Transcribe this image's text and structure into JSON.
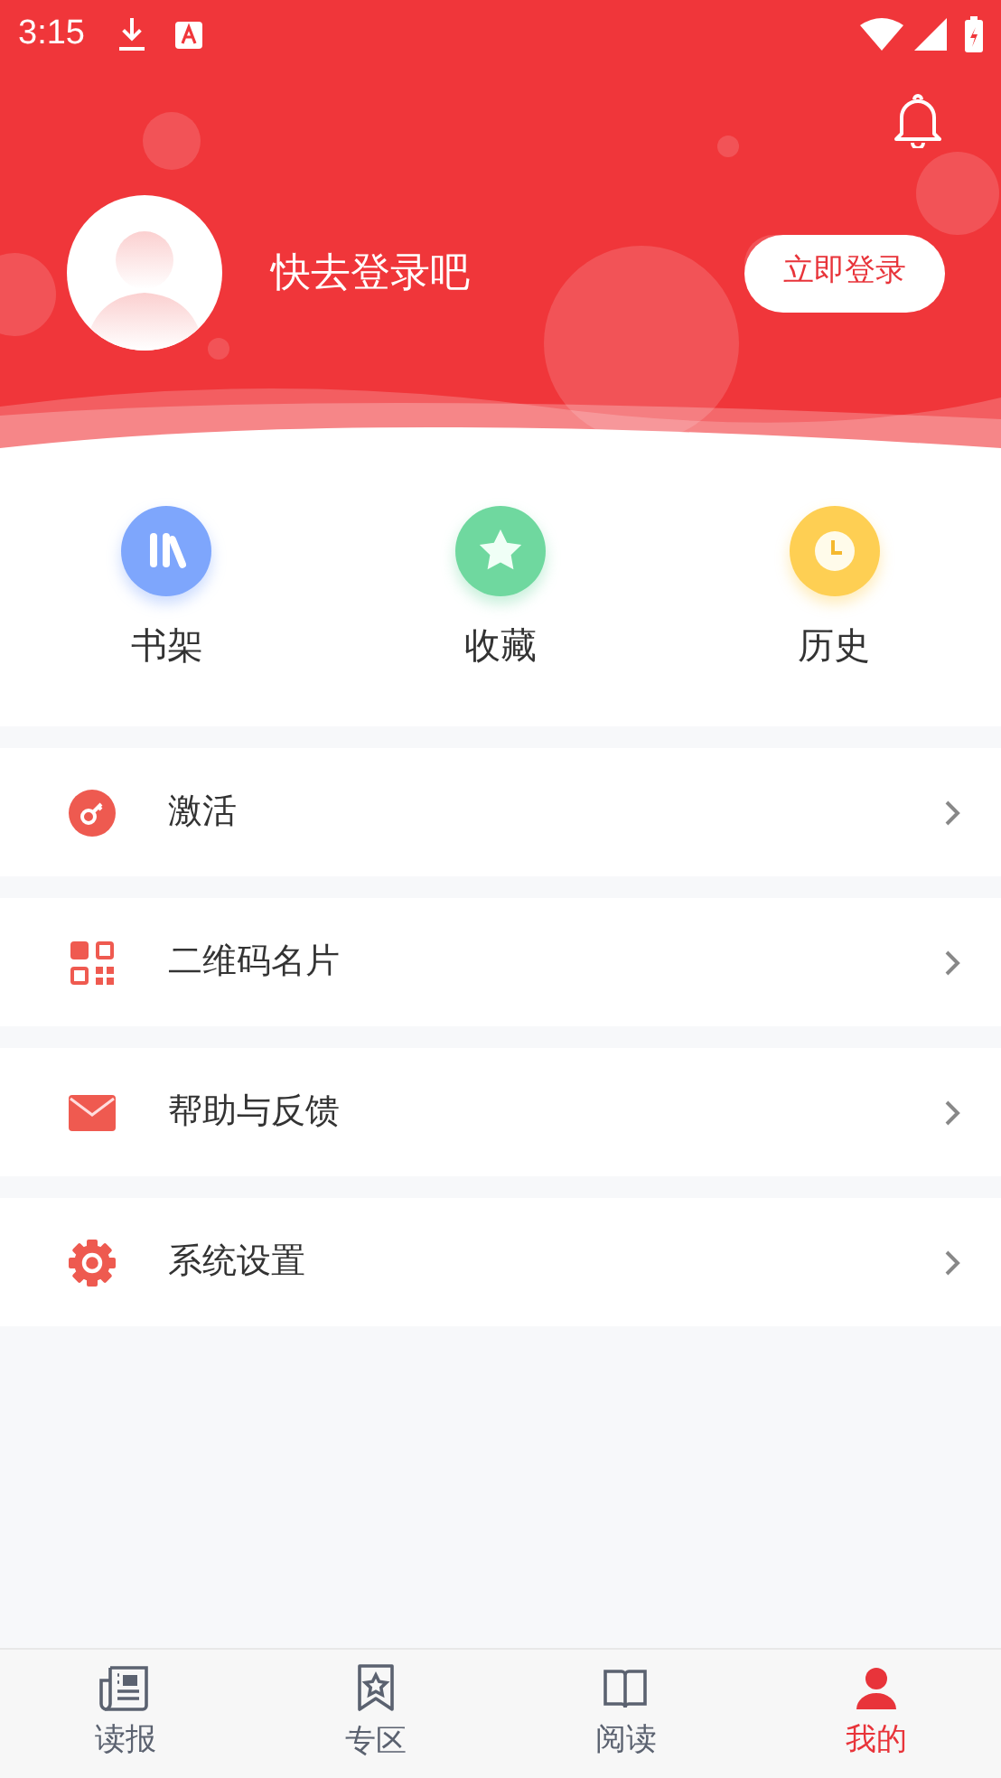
{
  "status_bar": {
    "time": "3:15"
  },
  "header": {
    "prompt": "快去登录吧",
    "login_button": "立即登录"
  },
  "shortcuts": [
    {
      "label": "书架",
      "kind": "shelf",
      "color": "#7ea6fc"
    },
    {
      "label": "收藏",
      "kind": "star",
      "color": "#6fd89f"
    },
    {
      "label": "历史",
      "kind": "clock",
      "color": "#fecf53"
    }
  ],
  "menu": [
    {
      "label": "激活",
      "kind": "key"
    },
    {
      "label": "二维码名片",
      "kind": "qr"
    },
    {
      "label": "帮助与反馈",
      "kind": "mail"
    },
    {
      "label": "系统设置",
      "kind": "gear"
    }
  ],
  "tabs": [
    {
      "label": "读报",
      "kind": "news",
      "selected": false
    },
    {
      "label": "专区",
      "kind": "bookmark",
      "selected": false
    },
    {
      "label": "阅读",
      "kind": "book",
      "selected": false
    },
    {
      "label": "我的",
      "kind": "person",
      "selected": true
    }
  ]
}
